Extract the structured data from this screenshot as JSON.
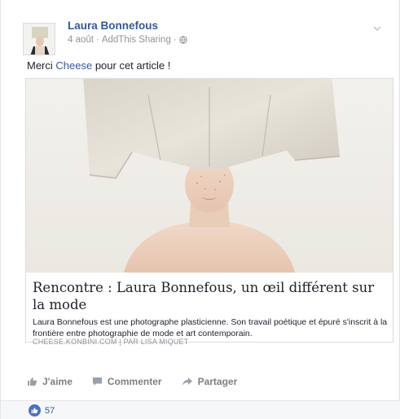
{
  "post": {
    "author": "Laura Bonnefous",
    "date": "4 août",
    "separator": "·",
    "source_app": "AddThis Sharing",
    "message_prefix": "Merci ",
    "message_mention": "Cheese",
    "message_suffix": " pour cet article !"
  },
  "link_preview": {
    "title": "Rencontre : Laura Bonnefous, un œil différent sur la mode",
    "description": "Laura Bonnefous est une photographe plasticienne. Son travail poétique et épuré s'inscrit à la frontière entre photographie de mode et art contemporain.",
    "source": "CHEESE.KONBINI.COM",
    "author_prefix": "PAR LISA MIQUET",
    "source_separator": "|"
  },
  "actions": {
    "like": "J'aime",
    "comment": "Commenter",
    "share": "Partager"
  },
  "reactions": {
    "count": "57"
  },
  "colors": {
    "link_blue": "#365899",
    "meta_gray": "#90949c",
    "action_gray": "#7f7f7f",
    "like_blue": "#4b72c0"
  },
  "icons": {
    "globe": "globe-icon",
    "chevron": "chevron-down-icon",
    "like": "thumbs-up-icon",
    "comment": "speech-bubble-icon",
    "share": "share-arrow-icon"
  }
}
